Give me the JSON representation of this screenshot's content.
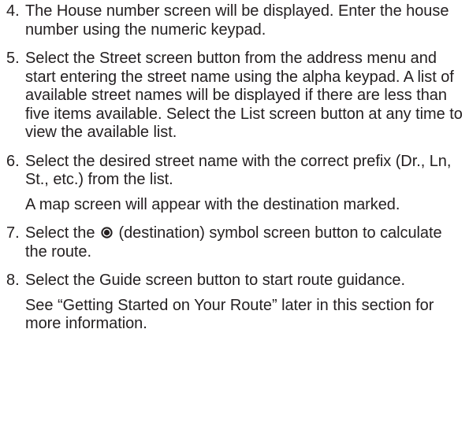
{
  "steps": [
    {
      "number": "4.",
      "text": "The House number screen will be displayed. Enter the house number using the numeric keypad."
    },
    {
      "number": "5.",
      "text": "Select the Street screen button from the address menu and start entering the street name using the alpha keypad. A list of available street names will be displayed if there are less than five items available. Select the List screen button at any time to view the available list."
    },
    {
      "number": "6.",
      "text": "Select the desired street name with the correct prefix (Dr., Ln, St., etc.) from the list.",
      "note": "A map screen will appear with the destination marked."
    },
    {
      "number": "7.",
      "text_before": "Select the",
      "symbol_icon": "destination-symbol-icon",
      "text_after": "(destination) symbol screen button to calculate the route."
    },
    {
      "number": "8.",
      "text": "Select the Guide screen button to start route guidance.",
      "note": "See “Getting Started on Your Route” later in this section for more information."
    }
  ]
}
